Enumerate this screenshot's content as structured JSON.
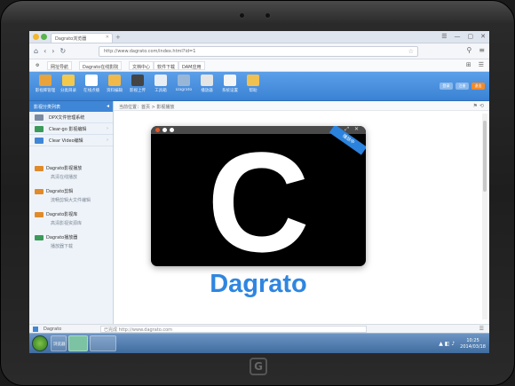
{
  "browser": {
    "tab_title": "Dagrato浏览器",
    "tab_close": "✕",
    "new_tab": "+",
    "window_controls": [
      "☰",
      "—",
      "▢",
      "✕"
    ],
    "nav_icons": [
      "⌂",
      "‹",
      "›",
      "↻"
    ],
    "url": "http://www.dagrato.com/index.html?id=1",
    "bookmarks": [
      "网址导航",
      "Dagrato在线影院",
      "文档中心",
      "软件下载",
      "DAM应用"
    ],
    "addr_right_icons": [
      "⚲",
      "≡"
    ],
    "bm_right_icons": [
      "⊞",
      "☰"
    ]
  },
  "toolbar": {
    "items": [
      {
        "label": "影视库管理",
        "color": "#e8a33b"
      },
      {
        "label": "分类目录",
        "color": "#f2c94c"
      },
      {
        "label": "在线点播",
        "color": "#ffffff"
      },
      {
        "label": "资料编辑",
        "color": "#f1b94a"
      },
      {
        "label": "影视上传",
        "color": "#444444"
      },
      {
        "label": "工具箱",
        "color": "#e9eef5"
      },
      {
        "label": "Dagrato",
        "color": "#9ab6d6"
      },
      {
        "label": "播放器",
        "color": "#e5e5e5"
      },
      {
        "label": "系统设置",
        "color": "#f5f5f5"
      },
      {
        "label": "帮助",
        "color": "#f0c050"
      }
    ],
    "right_buttons": [
      {
        "label": "登录",
        "color": "#8ab8ec"
      },
      {
        "label": "注册",
        "color": "#8ab8ec"
      },
      {
        "label": "退出",
        "color": "#f08a2c"
      }
    ]
  },
  "sidebar": {
    "header": "影视分类列表",
    "rows": [
      {
        "label": "DPX文件管理系统",
        "color": "#7a8aa0"
      },
      {
        "label": "Clear-go 影视编辑",
        "color": "#3b9a5a"
      },
      {
        "label": "Clear Video编辑",
        "color": "#3f86d6"
      }
    ],
    "groups": [
      {
        "title": "Dagrato影视播放",
        "sub": "高清在线播放",
        "color": "#e08a2a"
      },
      {
        "title": "Dagrato剪辑",
        "sub": "流畅剪辑大文件编辑",
        "color": "#e08a2a"
      },
      {
        "title": "Dagrato影视库",
        "sub": "高清影视资源库",
        "color": "#e08a2a"
      },
      {
        "title": "Dagrato播放器",
        "sub": "播放器下载",
        "color": "#3b9a5a"
      }
    ]
  },
  "main": {
    "breadcrumb": "当前位置：首页 > 影视播放",
    "crumb_icons": "⚑ ⟲",
    "player": {
      "letter": "C",
      "badge": "播放中",
      "controls": "⤢ ✕"
    },
    "wordmark": "Dagrato"
  },
  "status": {
    "label": "Dagrato",
    "text": "已完成 http://www.dagrato.com",
    "right": "☰"
  },
  "taskbar": {
    "apps": [
      {
        "label": "浏览器"
      },
      {
        "label": ""
      },
      {
        "label": ""
      }
    ],
    "tray_icons": "▲ ◧ ♪",
    "time": "10:25",
    "date": "2014/03/18"
  },
  "device": {
    "home_glyph": "G"
  }
}
